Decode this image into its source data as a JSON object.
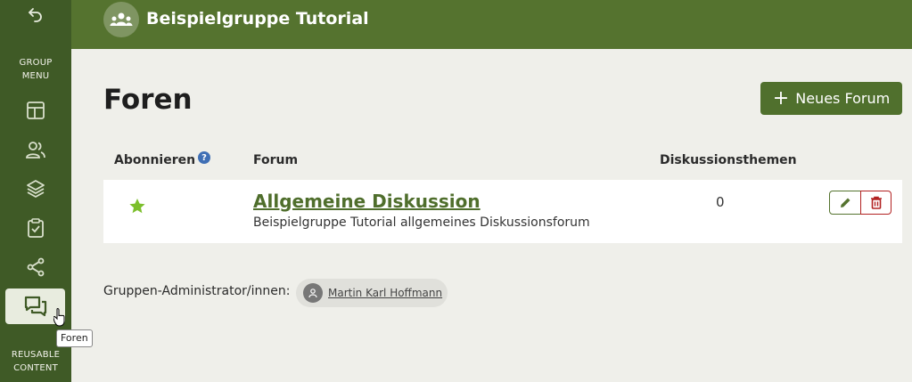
{
  "sidebar": {
    "group_menu_line1": "GROUP",
    "group_menu_line2": "MENU",
    "reusable_line1": "REUSABLE",
    "reusable_line2": "CONTENT",
    "tooltip": "Foren",
    "accent_color": "#3f5a26"
  },
  "header": {
    "group_title": "Beispielgruppe Tutorial",
    "color": "#55732f"
  },
  "main": {
    "page_title": "Foren",
    "new_forum_label": "Neues Forum",
    "columns": {
      "subscribe": "Abonnieren",
      "forum": "Forum",
      "topics": "Diskussionsthemen"
    },
    "help_glyph": "?",
    "forums": [
      {
        "name": "Allgemeine Diskussion",
        "description": "Beispielgruppe Tutorial allgemeines Diskussionsforum",
        "topic_count": "0",
        "subscribed_icon": "star-icon"
      }
    ],
    "admins_label": "Gruppen-Administrator/innen:",
    "admins": [
      {
        "name": "Martin Karl Hoffmann"
      }
    ]
  }
}
